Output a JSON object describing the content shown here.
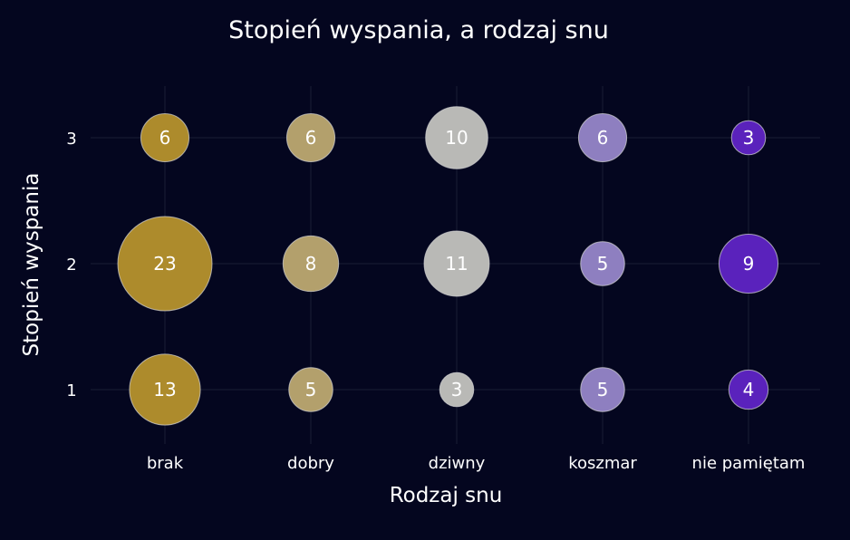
{
  "chart_data": {
    "type": "scatter",
    "title": "Stopień wyspania, a rodzaj snu",
    "xlabel": "Rodzaj snu",
    "ylabel": "Stopień wyspania",
    "categories": [
      "brak",
      "dobry",
      "dziwny",
      "koszmar",
      "nie pamiętam"
    ],
    "y_levels": [
      1,
      2,
      3
    ],
    "grid": true,
    "colors": {
      "background": "#04061f",
      "grid": "#1a1d35",
      "brak": "#ad8b2c",
      "dobry": "#b3a06c",
      "dziwny": "#b9b9b6",
      "koszmar": "#8e7fc0",
      "nie pamiętam": "#5a22bc",
      "bubble_outline": "#d8d8d8",
      "text": "#ffffff"
    },
    "points": [
      {
        "x": "brak",
        "y": 1,
        "count": 13
      },
      {
        "x": "brak",
        "y": 2,
        "count": 23
      },
      {
        "x": "brak",
        "y": 3,
        "count": 6
      },
      {
        "x": "dobry",
        "y": 1,
        "count": 5
      },
      {
        "x": "dobry",
        "y": 2,
        "count": 8
      },
      {
        "x": "dobry",
        "y": 3,
        "count": 6
      },
      {
        "x": "dziwny",
        "y": 1,
        "count": 3
      },
      {
        "x": "dziwny",
        "y": 2,
        "count": 11
      },
      {
        "x": "dziwny",
        "y": 3,
        "count": 10
      },
      {
        "x": "koszmar",
        "y": 1,
        "count": 5
      },
      {
        "x": "koszmar",
        "y": 2,
        "count": 5
      },
      {
        "x": "koszmar",
        "y": 3,
        "count": 6
      },
      {
        "x": "nie pamiętam",
        "y": 1,
        "count": 4
      },
      {
        "x": "nie pamiętam",
        "y": 2,
        "count": 9
      },
      {
        "x": "nie pamiętam",
        "y": 3,
        "count": 3
      }
    ]
  }
}
